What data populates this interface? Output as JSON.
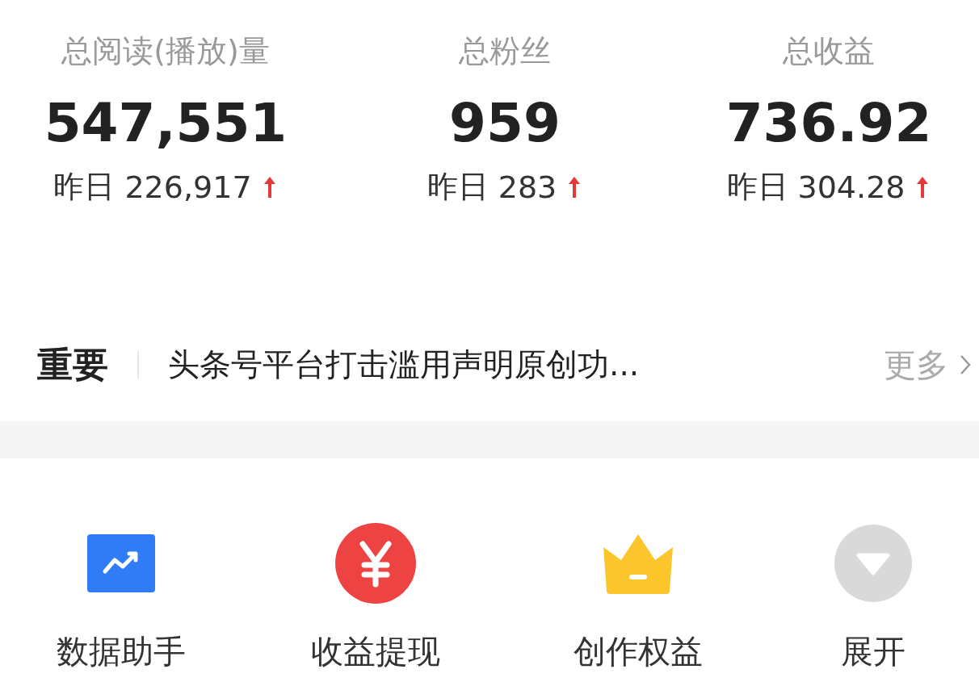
{
  "stats": [
    {
      "label": "总阅读(播放)量",
      "value": "547,551",
      "yesterday_label": "昨日",
      "yesterday": "226,917",
      "rising": true
    },
    {
      "label": "总粉丝",
      "value": "959",
      "yesterday_label": "昨日",
      "yesterday": "283",
      "rising": true
    },
    {
      "label": "总收益",
      "value": "736.92",
      "yesterday_label": "昨日",
      "yesterday": "304.28",
      "rising": true
    }
  ],
  "notice": {
    "tag": "重要",
    "text": "头条号平台打击滥用声明原创功...",
    "more": "更多"
  },
  "shortcuts": [
    {
      "kind": "chart",
      "label": "数据助手"
    },
    {
      "kind": "yen",
      "label": "收益提现"
    },
    {
      "kind": "crown",
      "label": "创作权益"
    },
    {
      "kind": "expand",
      "label": "展开"
    }
  ]
}
